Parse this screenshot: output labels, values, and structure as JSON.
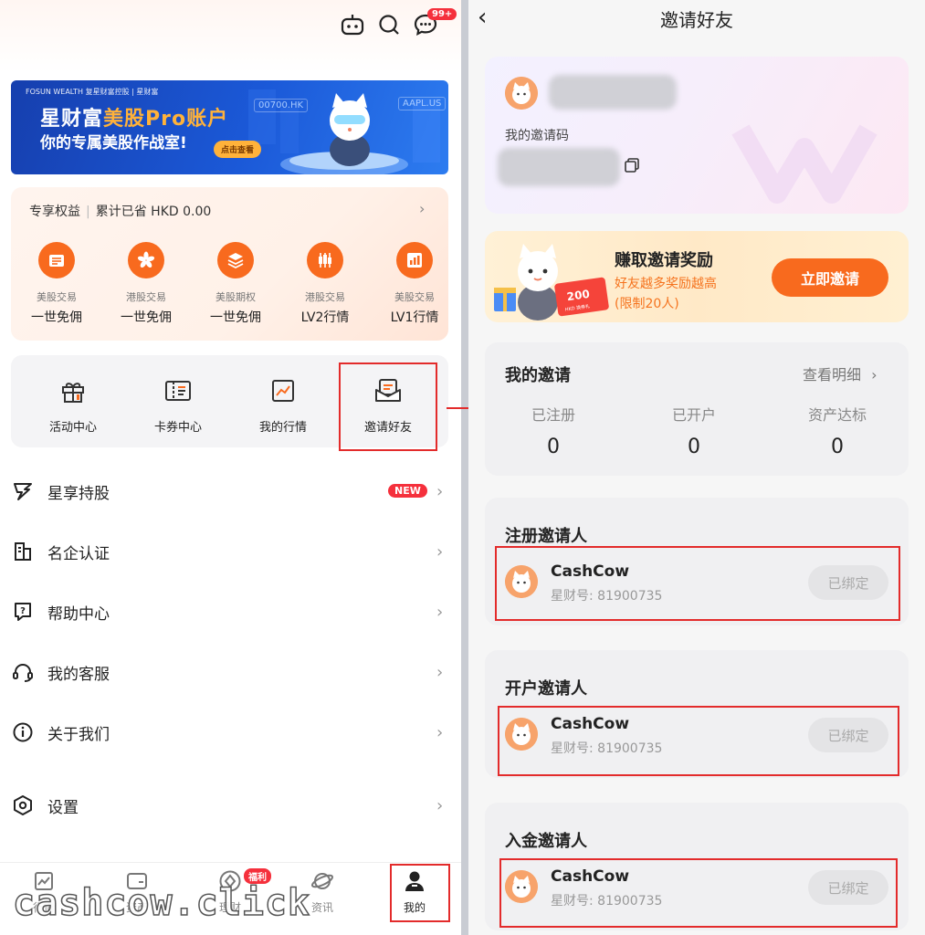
{
  "left": {
    "top_icons": [
      "robot-icon",
      "search-icon",
      "message-icon"
    ],
    "message_badge": "99+",
    "banner": {
      "brand": "FOSUN WEALTH 复星财富控股 | 星财富",
      "title_prefix": "星财富",
      "title_highlight": "美股Pro账户",
      "subtitle": "你的专属美股作战室!",
      "button": "点击查看",
      "tickers": [
        "00700.HK",
        "AAPL.US"
      ]
    },
    "benefits": {
      "label": "专享权益",
      "saved": "累计已省 HKD 0.00",
      "items": [
        {
          "icon": "us-stock-icon",
          "line1": "美股交易",
          "line2": "一世免佣"
        },
        {
          "icon": "hk-stock-icon",
          "line1": "港股交易",
          "line2": "一世免佣"
        },
        {
          "icon": "options-icon",
          "line1": "美股期权",
          "line2": "一世免佣"
        },
        {
          "icon": "candlestick-icon",
          "line1": "港股交易",
          "line2": "LV2行情"
        },
        {
          "icon": "bar-chart-icon",
          "line1": "美股交易",
          "line2": "LV1行情"
        }
      ]
    },
    "quick_actions": [
      {
        "icon": "gift-icon",
        "label": "活动中心"
      },
      {
        "icon": "ticket-icon",
        "label": "卡券中心"
      },
      {
        "icon": "trend-chart-icon",
        "label": "我的行情"
      },
      {
        "icon": "envelope-icon",
        "label": "邀请好友"
      }
    ],
    "menu": [
      {
        "icon": "star-holding-icon",
        "label": "星享持股",
        "badge": "NEW"
      },
      {
        "icon": "company-icon",
        "label": "名企认证"
      },
      {
        "icon": "help-icon",
        "label": "帮助中心"
      },
      {
        "icon": "headset-icon",
        "label": "我的客服"
      },
      {
        "icon": "info-icon",
        "label": "关于我们"
      },
      {
        "icon": "settings-icon",
        "label": "设置"
      }
    ],
    "tabs": [
      {
        "icon": "market-icon",
        "label": "行情"
      },
      {
        "icon": "wallet-icon",
        "label": "资产"
      },
      {
        "icon": "wealth-icon",
        "label": "理财",
        "badge": "福利"
      },
      {
        "icon": "planet-icon",
        "label": "资讯"
      },
      {
        "icon": "user-icon",
        "label": "我的"
      }
    ],
    "watermark": "cashcow.click"
  },
  "right": {
    "title": "邀请好友",
    "invite_code_label": "我的邀请码",
    "reward": {
      "title": "赚取邀请奖励",
      "sub1": "好友越多奖励越高",
      "sub2": "(限制20人)",
      "button": "立即邀请",
      "ticket_value": "200",
      "ticket_unit": "HKD 换券礼"
    },
    "my_invite": {
      "title": "我的邀请",
      "detail": "查看明细",
      "stats": [
        {
          "label": "已注册",
          "value": "0"
        },
        {
          "label": "已开户",
          "value": "0"
        },
        {
          "label": "资产达标",
          "value": "0"
        }
      ]
    },
    "inviters": [
      {
        "title": "注册邀请人",
        "name": "CashCow",
        "id": "星财号: 81900735",
        "button": "已绑定"
      },
      {
        "title": "开户邀请人",
        "name": "CashCow",
        "id": "星财号: 81900735",
        "button": "已绑定"
      },
      {
        "title": "入金邀请人",
        "name": "CashCow",
        "id": "星财号: 81900735",
        "button": "已绑定"
      }
    ]
  },
  "colors": {
    "accent": "#f86a1e",
    "highlight_box": "#e32b2b",
    "badge": "#f5303c"
  }
}
